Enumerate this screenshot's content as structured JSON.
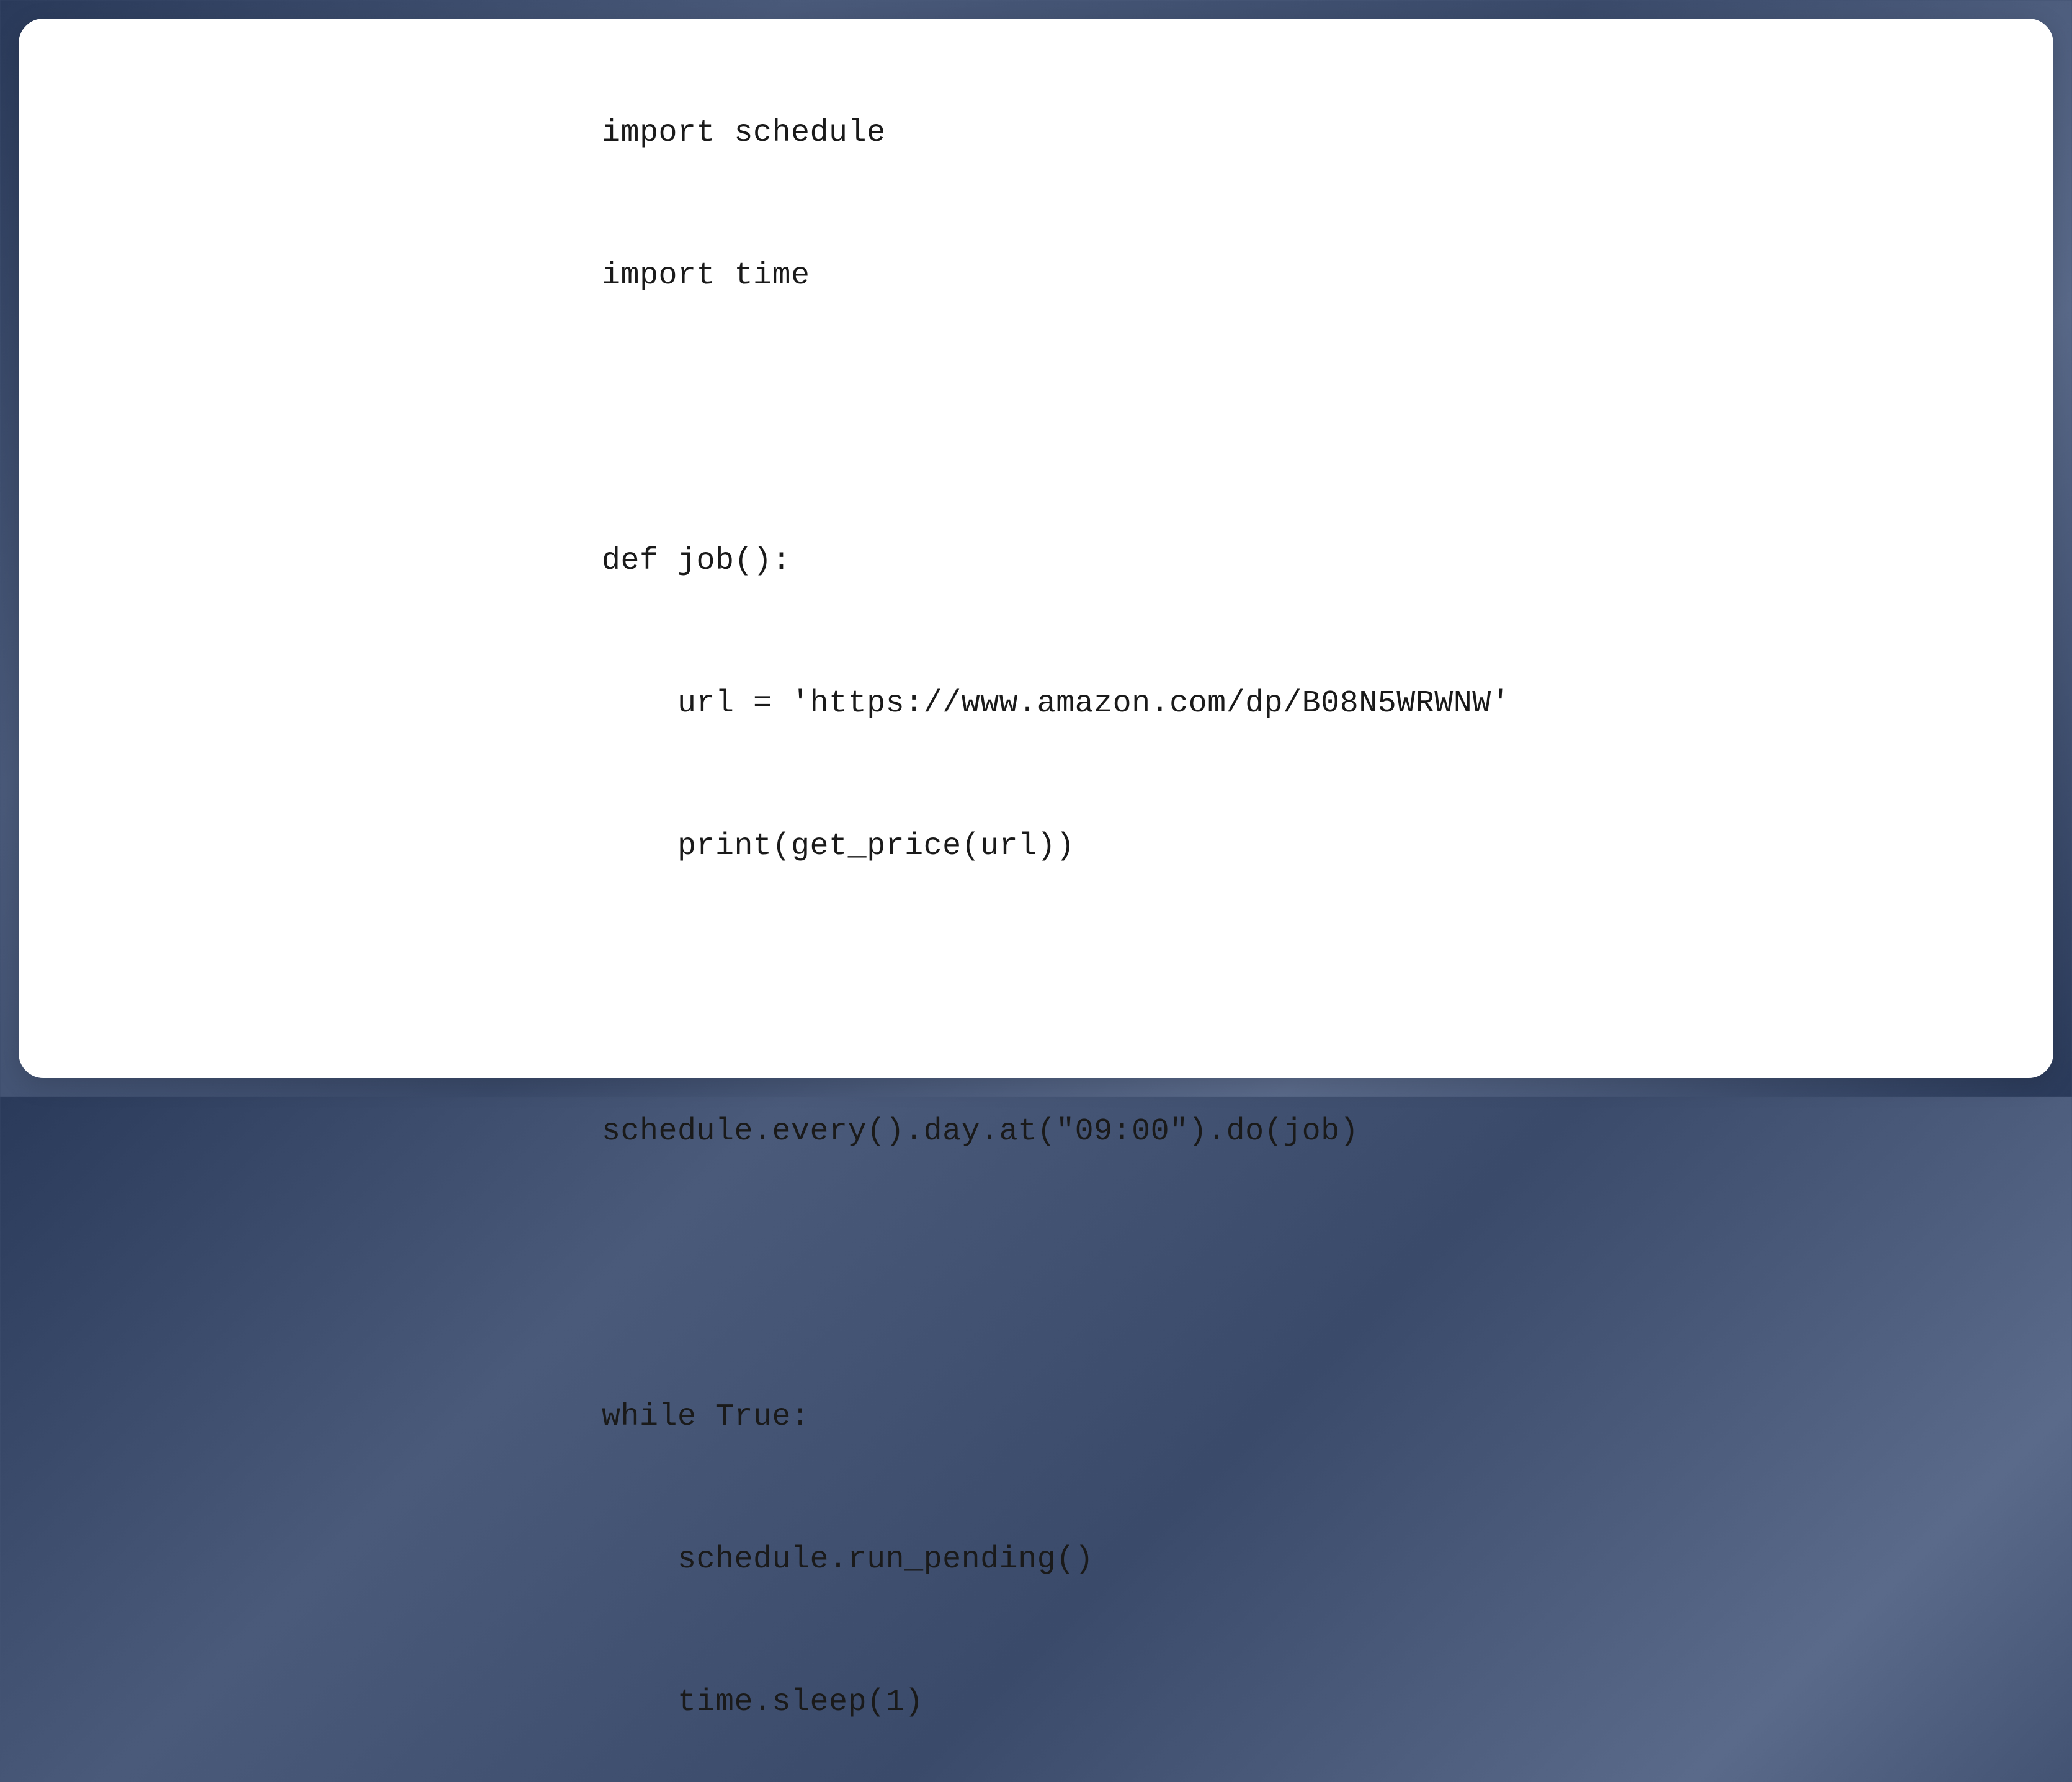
{
  "code": {
    "lines": [
      "import schedule",
      "import time",
      "",
      "def job():",
      "    url = 'https://www.amazon.com/dp/B08N5WRWNW'",
      "    print(get_price(url))",
      "",
      "schedule.every().day.at(\"09:00\").do(job)",
      "",
      "while True:",
      "    schedule.run_pending()",
      "    time.sleep(1)"
    ]
  }
}
